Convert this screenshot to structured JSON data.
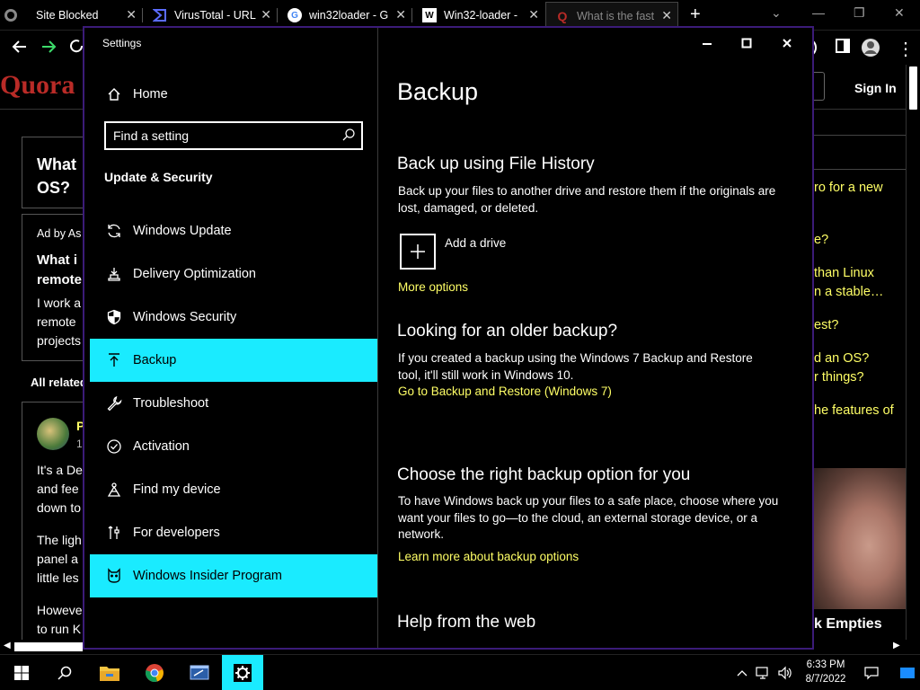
{
  "browser": {
    "tabs": [
      {
        "title": "Site Blocked",
        "icon": "blocked-globe-icon"
      },
      {
        "title": "VirusTotal - URL",
        "icon": "virustotal-icon"
      },
      {
        "title": "win32loader - G",
        "icon": "google-icon"
      },
      {
        "title": "Win32-loader -",
        "icon": "wikipedia-icon"
      },
      {
        "title": "What is the fast",
        "icon": "quora-icon"
      }
    ],
    "new_tab": "+"
  },
  "quora": {
    "logo": "Quora",
    "sign_in": "Sign In",
    "question_title_lines": [
      "What",
      "OS?"
    ],
    "ad_by": "Ad by As",
    "ad_headline_lines": [
      "What i",
      "remote"
    ],
    "ad_body_lines": [
      "I work a",
      "remote",
      "projects"
    ],
    "all_related": "All related",
    "answer_author_initial": "P",
    "answer_meta": "1",
    "answer_lines": [
      "It's a De",
      "and fee",
      "down to",
      "",
      "The ligh",
      "panel a",
      "little les",
      "",
      "Howeve",
      "to run K"
    ],
    "right_links": [
      "ro for a new",
      "e?",
      "than Linux",
      "n a stable…",
      "est?",
      "d an OS?",
      "r things?",
      "he features of"
    ],
    "right_ad_title": "k Empties"
  },
  "settings": {
    "window_title": "Settings",
    "home_label": "Home",
    "search_placeholder": "Find a setting",
    "section_title": "Update & Security",
    "nav_items": [
      {
        "label": "Windows Update",
        "icon": "refresh-icon"
      },
      {
        "label": "Delivery Optimization",
        "icon": "delivery-optimization-icon"
      },
      {
        "label": "Windows Security",
        "icon": "shield-icon"
      },
      {
        "label": "Backup",
        "icon": "backup-arrow-icon",
        "selected": true
      },
      {
        "label": "Troubleshoot",
        "icon": "wrench-icon"
      },
      {
        "label": "Activation",
        "icon": "check-circle-icon"
      },
      {
        "label": "Find my device",
        "icon": "find-device-icon"
      },
      {
        "label": "For developers",
        "icon": "developer-tools-icon"
      },
      {
        "label": "Windows Insider Program",
        "icon": "insider-cat-icon",
        "highlighted": true
      }
    ],
    "page_title": "Backup",
    "file_history": {
      "heading": "Back up using File History",
      "description": "Back up your files to another drive and restore them if the originals are lost, damaged, or deleted.",
      "add_drive": "Add a drive",
      "more_options": "More options"
    },
    "older_backup": {
      "heading": "Looking for an older backup?",
      "description": "If you created a backup using the Windows 7 Backup and Restore tool, it'll still work in Windows 10.",
      "link": "Go to Backup and Restore (Windows 7)"
    },
    "right_option": {
      "heading": "Choose the right backup option for you",
      "description": "To have Windows back up your files to a safe place, choose where you want your files to go—to the cloud, an external storage device, or a network.",
      "link": "Learn more about backup options"
    },
    "help_heading": "Help from the web"
  },
  "taskbar": {
    "time": "6:33 PM",
    "date": "8/7/2022",
    "apps": [
      "file-explorer-icon",
      "chrome-icon",
      "app-window-icon",
      "settings-gear-icon"
    ]
  },
  "colors": {
    "accent": "#1aebff",
    "link": "#ffff66",
    "window_border": "#3b1b78",
    "quora_red": "#b92b27"
  }
}
